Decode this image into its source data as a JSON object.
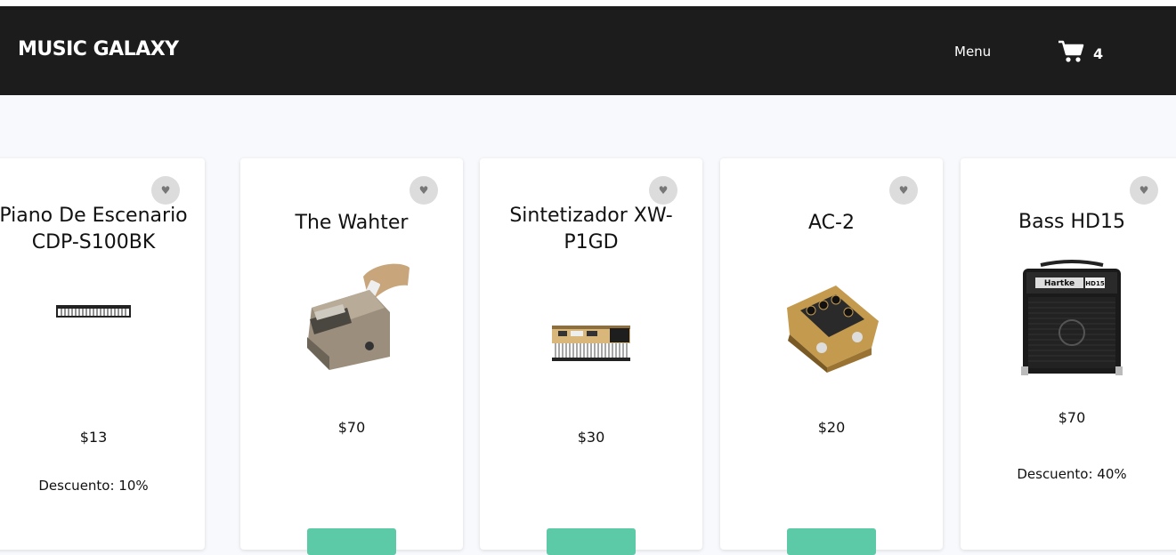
{
  "header": {
    "brand": "MUSIC GALAXY",
    "menu_label": "Menu",
    "cart_count": "4",
    "colors": {
      "background": "#1b1c1b",
      "text": "#ffffff"
    }
  },
  "products": [
    {
      "title": "Piano De Escenario CDP-S100BK",
      "price": "$13",
      "discount": "Descuento: 10%",
      "image": "stage-piano-image"
    },
    {
      "title": "The Wahter",
      "price": "$70",
      "image": "wah-pedal-image"
    },
    {
      "title": "Sintetizador XW-P1GD",
      "price": "$30",
      "image": "synthesizer-image"
    },
    {
      "title": "AC-2",
      "price": "$20",
      "image": "acoustic-pedal-image"
    },
    {
      "title": "Bass HD15",
      "price": "$70",
      "discount": "Descuento: 40%",
      "image": "bass-amp-image",
      "amp_brand": "Hartke",
      "amp_model": "HD15"
    }
  ],
  "ui": {
    "favorite_icon": "heart-icon",
    "accent_color": "#5cc9a7"
  }
}
